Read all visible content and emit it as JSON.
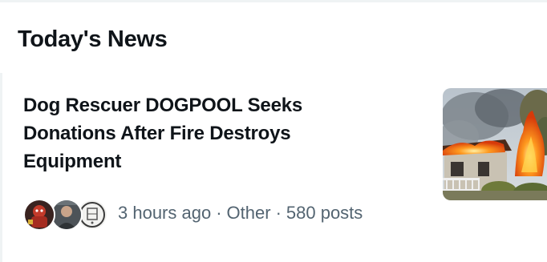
{
  "section": {
    "title": "Today's News"
  },
  "news_item": {
    "headline": "Dog Rescuer DOGPOOL Seeks Donations After Fire Destroys Equipment",
    "time": "3 hours ago",
    "separator": "·",
    "category": "Other",
    "posts": "580 posts",
    "thumbnail_icon": "house-fire-photo",
    "avatars": [
      {
        "icon": "avatar-red-character"
      },
      {
        "icon": "avatar-photo"
      },
      {
        "icon": "avatar-sketch"
      }
    ]
  },
  "colors": {
    "text_primary": "#0f1419",
    "text_secondary": "#536471",
    "divider": "#eff3f4",
    "background": "#ffffff"
  }
}
